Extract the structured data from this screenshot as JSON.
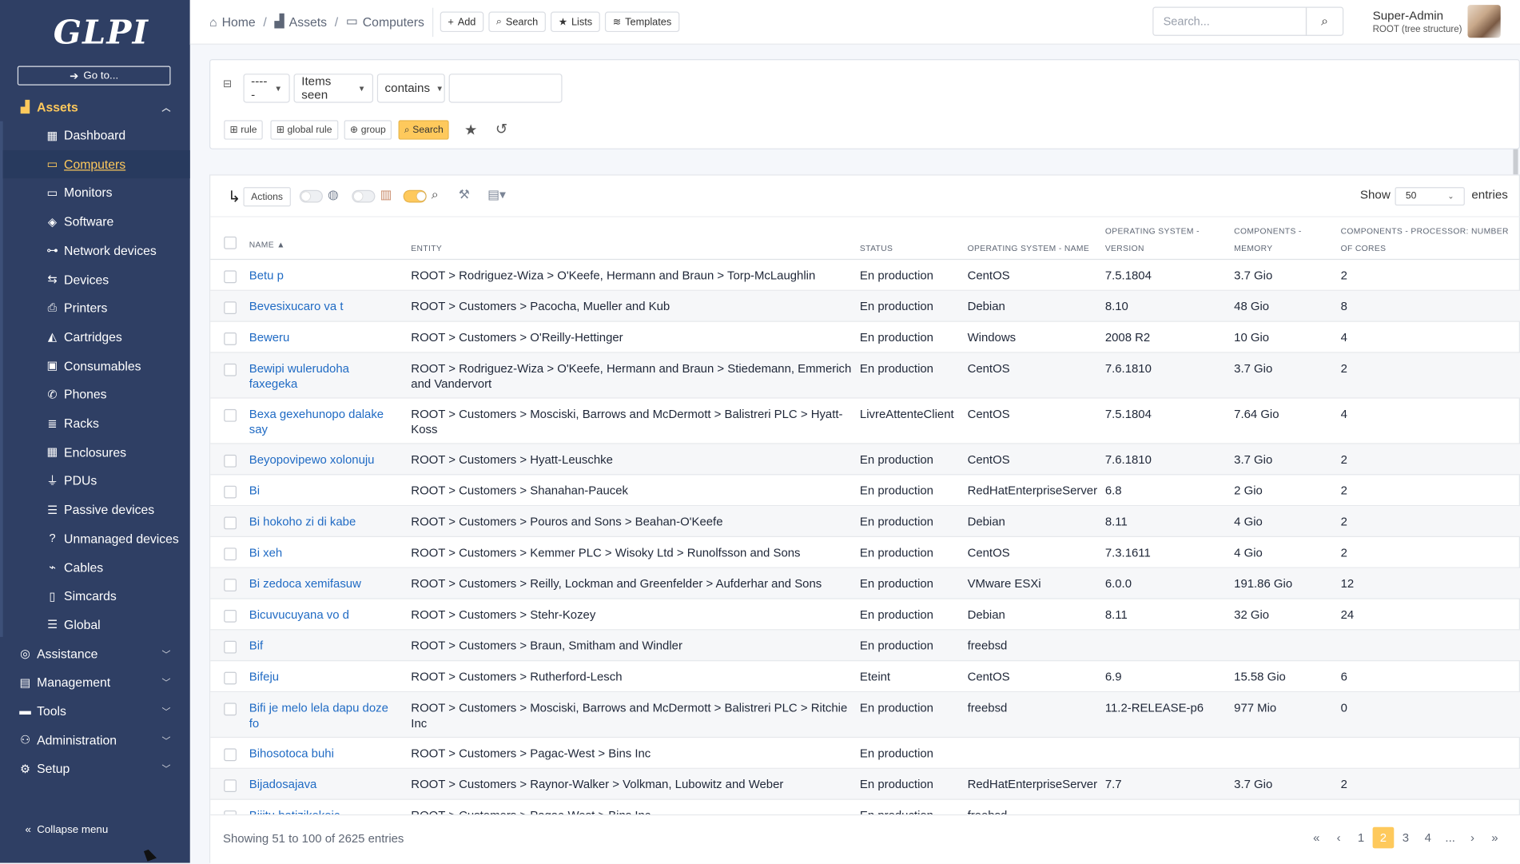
{
  "sidebar": {
    "logo": "GLPI",
    "goto_label": "Go to...",
    "assets_label": "Assets",
    "items": [
      {
        "label": "Dashboard",
        "icon": "dashboard-icon",
        "active": false
      },
      {
        "label": "Computers",
        "icon": "laptop-icon",
        "active": true
      },
      {
        "label": "Monitors",
        "icon": "monitor-icon",
        "active": false
      },
      {
        "label": "Software",
        "icon": "box-icon",
        "active": false
      },
      {
        "label": "Network devices",
        "icon": "network-icon",
        "active": false
      },
      {
        "label": "Devices",
        "icon": "usb-icon",
        "active": false
      },
      {
        "label": "Printers",
        "icon": "printer-icon",
        "active": false
      },
      {
        "label": "Cartridges",
        "icon": "fill-drip-icon",
        "active": false
      },
      {
        "label": "Consumables",
        "icon": "boxes-icon",
        "active": false
      },
      {
        "label": "Phones",
        "icon": "phone-icon",
        "active": false
      },
      {
        "label": "Racks",
        "icon": "server-icon",
        "active": false
      },
      {
        "label": "Enclosures",
        "icon": "grid-icon",
        "active": false
      },
      {
        "label": "PDUs",
        "icon": "plug-icon",
        "active": false
      },
      {
        "label": "Passive devices",
        "icon": "list-icon",
        "active": false
      },
      {
        "label": "Unmanaged devices",
        "icon": "question-icon",
        "active": false
      },
      {
        "label": "Cables",
        "icon": "cable-icon",
        "active": false
      },
      {
        "label": "Simcards",
        "icon": "simcard-icon",
        "active": false
      },
      {
        "label": "Global",
        "icon": "list-icon",
        "active": false
      }
    ],
    "sections": [
      {
        "label": "Assistance",
        "icon": "assistance-icon"
      },
      {
        "label": "Management",
        "icon": "management-icon"
      },
      {
        "label": "Tools",
        "icon": "briefcase-icon"
      },
      {
        "label": "Administration",
        "icon": "users-cog-icon"
      },
      {
        "label": "Setup",
        "icon": "cogs-icon"
      }
    ],
    "collapse_label": "Collapse menu"
  },
  "header": {
    "breadcrumb": [
      "Home",
      "Assets",
      "Computers"
    ],
    "buttons": [
      "Add",
      "Search",
      "Lists",
      "Templates"
    ],
    "search_placeholder": "Search...",
    "user_name": "Super-Admin",
    "user_entity": "ROOT (tree structure)"
  },
  "search_box": {
    "field_select": "-----",
    "criteria_select": "Items seen",
    "operator_select": "contains",
    "value": "",
    "buttons": [
      "rule",
      "global rule",
      "group",
      "Search"
    ]
  },
  "table": {
    "actions_label": "Actions",
    "show_label": "Show",
    "show_value": "50",
    "entries_label": "entries",
    "columns": [
      {
        "l1": "NAME",
        "l2": ""
      },
      {
        "l1": "ENTITY",
        "l2": ""
      },
      {
        "l1": "STATUS",
        "l2": ""
      },
      {
        "l1": "OPERATING SYSTEM - NAME",
        "l2": ""
      },
      {
        "l1": "OPERATING SYSTEM -",
        "l2": "VERSION"
      },
      {
        "l1": "COMPONENTS -",
        "l2": "MEMORY"
      },
      {
        "l1": "COMPONENTS - PROCESSOR: NUMBER",
        "l2": "OF CORES"
      }
    ],
    "rows": [
      {
        "name": [
          "Betu p"
        ],
        "entity": [
          "ROOT > Rodriguez-Wiza > O'Keefe, Hermann and Braun > Torp-McLaughlin"
        ],
        "status": "En production",
        "os": "CentOS",
        "ver": "7.5.1804",
        "mem": "3.7 Gio",
        "cores": "2"
      },
      {
        "name": [
          "Bevesixucaro va t"
        ],
        "entity": [
          "ROOT > Customers > Pacocha, Mueller and Kub"
        ],
        "status": "En production",
        "os": "Debian",
        "ver": "8.10",
        "mem": "48 Gio",
        "cores": "8"
      },
      {
        "name": [
          "Beweru"
        ],
        "entity": [
          "ROOT > Customers > O'Reilly-Hettinger"
        ],
        "status": "En production",
        "os": "Windows",
        "ver": "2008 R2",
        "mem": "10 Gio",
        "cores": "4"
      },
      {
        "name": [
          "Bewipi wulerudoha",
          "faxegeka"
        ],
        "entity": [
          "ROOT > Rodriguez-Wiza > O'Keefe, Hermann and Braun > Stiedemann, Emmerich",
          "and Vandervort"
        ],
        "status": "En production",
        "os": "CentOS",
        "ver": "7.6.1810",
        "mem": "3.7 Gio",
        "cores": "2"
      },
      {
        "name": [
          "Bexa gexehunopo dalake",
          "say"
        ],
        "entity": [
          "ROOT > Customers > Mosciski, Barrows and McDermott > Balistreri PLC > Hyatt-",
          "Koss"
        ],
        "status": "LivreAttenteClient",
        "os": "CentOS",
        "ver": "7.5.1804",
        "mem": "7.64 Gio",
        "cores": "4"
      },
      {
        "name": [
          "Beyopovipewo xolonuju"
        ],
        "entity": [
          "ROOT > Customers > Hyatt-Leuschke"
        ],
        "status": "En production",
        "os": "CentOS",
        "ver": "7.6.1810",
        "mem": "3.7 Gio",
        "cores": "2"
      },
      {
        "name": [
          "Bi"
        ],
        "entity": [
          "ROOT > Customers > Shanahan-Paucek"
        ],
        "status": "En production",
        "os": "RedHatEnterpriseServer",
        "ver": "6.8",
        "mem": "2 Gio",
        "cores": "2"
      },
      {
        "name": [
          "Bi hokoho zi di kabe"
        ],
        "entity": [
          "ROOT > Customers > Pouros and Sons > Beahan-O'Keefe"
        ],
        "status": "En production",
        "os": "Debian",
        "ver": "8.11",
        "mem": "4 Gio",
        "cores": "2"
      },
      {
        "name": [
          "Bi xeh"
        ],
        "entity": [
          "ROOT > Customers > Kemmer PLC > Wisoky Ltd > Runolfsson and Sons"
        ],
        "status": "En production",
        "os": "CentOS",
        "ver": "7.3.1611",
        "mem": "4 Gio",
        "cores": "2"
      },
      {
        "name": [
          "Bi zedoca xemifasuw"
        ],
        "entity": [
          "ROOT > Customers > Reilly, Lockman and Greenfelder > Aufderhar and Sons"
        ],
        "status": "En production",
        "os": "VMware ESXi",
        "ver": "6.0.0",
        "mem": "191.86 Gio",
        "cores": "12"
      },
      {
        "name": [
          "Bicuvucuyana vo d"
        ],
        "entity": [
          "ROOT > Customers > Stehr-Kozey"
        ],
        "status": "En production",
        "os": "Debian",
        "ver": "8.11",
        "mem": "32 Gio",
        "cores": "24"
      },
      {
        "name": [
          "Bif"
        ],
        "entity": [
          "ROOT > Customers > Braun, Smitham and Windler"
        ],
        "status": "En production",
        "os": "freebsd",
        "ver": "",
        "mem": "",
        "cores": ""
      },
      {
        "name": [
          "Bifeju"
        ],
        "entity": [
          "ROOT > Customers > Rutherford-Lesch"
        ],
        "status": "Eteint",
        "os": "CentOS",
        "ver": "6.9",
        "mem": "15.58 Gio",
        "cores": "6"
      },
      {
        "name": [
          "Bifi je melo lela dapu doze",
          "fo"
        ],
        "entity": [
          "ROOT > Customers > Mosciski, Barrows and McDermott > Balistreri PLC > Ritchie",
          "Inc"
        ],
        "status": "En production",
        "os": "freebsd",
        "ver": "11.2-RELEASE-p6",
        "mem": "977 Mio",
        "cores": "0"
      },
      {
        "name": [
          "Bihosotoca buhi"
        ],
        "entity": [
          "ROOT > Customers > Pagac-West > Bins Inc"
        ],
        "status": "En production",
        "os": "",
        "ver": "",
        "mem": "",
        "cores": ""
      },
      {
        "name": [
          "Bijadosajava"
        ],
        "entity": [
          "ROOT > Customers > Raynor-Walker > Volkman, Lubowitz and Weber"
        ],
        "status": "En production",
        "os": "RedHatEnterpriseServer",
        "ver": "7.7",
        "mem": "3.7 Gio",
        "cores": "2"
      },
      {
        "name": [
          "Bijitu batizikokoic"
        ],
        "entity": [
          "ROOT > Customers > Pagac-West > Bins Inc"
        ],
        "status": "En production",
        "os": "freebsd",
        "ver": "",
        "mem": "",
        "cores": ""
      }
    ],
    "footer_text": "Showing 51 to 100 of 2625 entries",
    "pages": [
      "1",
      "2",
      "3",
      "4",
      "..."
    ],
    "current_page": "2"
  }
}
